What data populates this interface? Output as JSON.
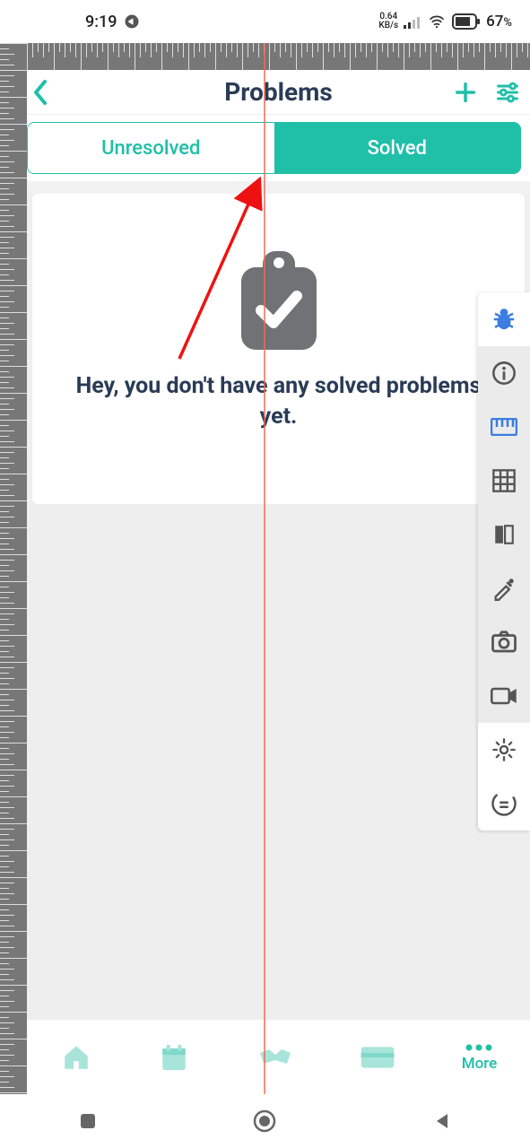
{
  "status": {
    "time": "9:19",
    "net_speed_top": "0.64",
    "net_speed_bottom": "KB/s",
    "battery_pct": "67",
    "battery_pct_sym": "%"
  },
  "header": {
    "title": "Problems"
  },
  "tabs": {
    "unresolved": "Unresolved",
    "solved": "Solved"
  },
  "empty": {
    "message": "Hey, you don't have any solved problems yet."
  },
  "bottomnav": {
    "more": "More"
  }
}
